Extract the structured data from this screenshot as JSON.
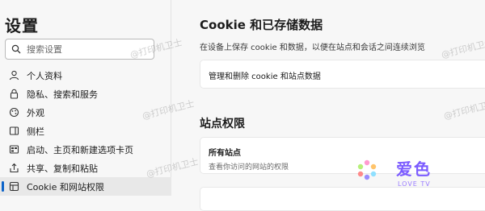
{
  "sidebar": {
    "title": "设置",
    "search": {
      "placeholder": "搜索设置"
    },
    "items": [
      {
        "label": "个人资料",
        "icon": "profile-icon"
      },
      {
        "label": "隐私、搜索和服务",
        "icon": "lock-icon"
      },
      {
        "label": "外观",
        "icon": "appearance-icon"
      },
      {
        "label": "侧栏",
        "icon": "sidebar-icon"
      },
      {
        "label": "启动、主页和新建选项卡页",
        "icon": "home-icon"
      },
      {
        "label": "共享、复制和粘贴",
        "icon": "share-icon"
      },
      {
        "label": "Cookie 和网站权限",
        "icon": "cookie-permissions-icon",
        "active": true
      }
    ]
  },
  "main": {
    "title": "Cookie 和已存储数据",
    "description": "在设备上保存 cookie 和数据，以便在站点和会话之间连续浏览",
    "manage_label": "管理和删除 cookie 和站点数据",
    "site_permissions": {
      "title": "站点权限",
      "all_sites_title": "所有站点",
      "all_sites_desc": "查看你访问的网站的权限"
    }
  },
  "watermark": {
    "text": "@打印机卫士"
  },
  "brand": {
    "name": "爱色",
    "sub": "LOVE TV"
  },
  "colors": {
    "accent": "#0b63c9",
    "brand": "#7c5cff"
  }
}
